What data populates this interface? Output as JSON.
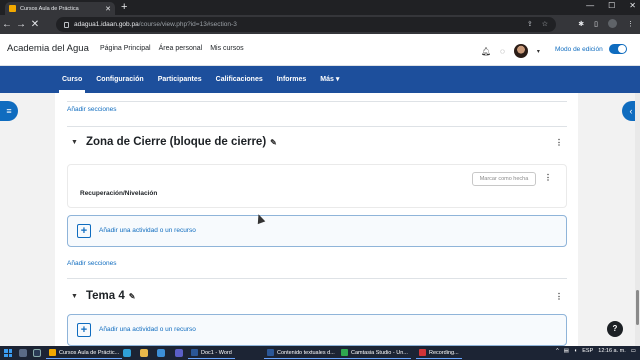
{
  "browser": {
    "tab_title": "Cursos Aula de Práctica",
    "url_host": "adagua1.idaan.gob.pa",
    "url_path": "/course/view.php?id=13#section-3"
  },
  "header": {
    "brand": "Academia del Agua",
    "nav": [
      "Página Principal",
      "Área personal",
      "Mis cursos"
    ],
    "edit_mode_label": "Modo de edición"
  },
  "course_nav": {
    "items": [
      "Curso",
      "Configuración",
      "Participantes",
      "Calificaciones",
      "Informes",
      "Más ▾"
    ],
    "active": "Curso"
  },
  "main": {
    "add_sections_label": "Añadir secciones",
    "sections": [
      {
        "title": "Zona de Cierre (bloque de cierre)",
        "activity_name": "Recuperación/Nivelación",
        "mark_done_label": "Marcar como hecha",
        "add_activity_label": "Añadir una actividad o un recurso"
      },
      {
        "title": "Tema 4",
        "add_activity_label": "Añadir una actividad o un recurso"
      }
    ]
  },
  "help_label": "?",
  "taskbar": {
    "apps": [
      {
        "label": "Cursos Aula de Práctic...",
        "color": "#f2a900"
      },
      {
        "label": "Doc1 - Word",
        "color": "#2b5797"
      },
      {
        "label": "Contenido textuales d...",
        "color": "#2b5797"
      },
      {
        "label": "Camtasia Studio - Un...",
        "color": "#2fa84f"
      },
      {
        "label": "Recording...",
        "color": "#d13438"
      }
    ],
    "language": "ESP",
    "time": "12:16 a. m."
  },
  "colors": {
    "brand_blue": "#0f6cbf",
    "course_nav_bg": "#1d4f9c"
  }
}
